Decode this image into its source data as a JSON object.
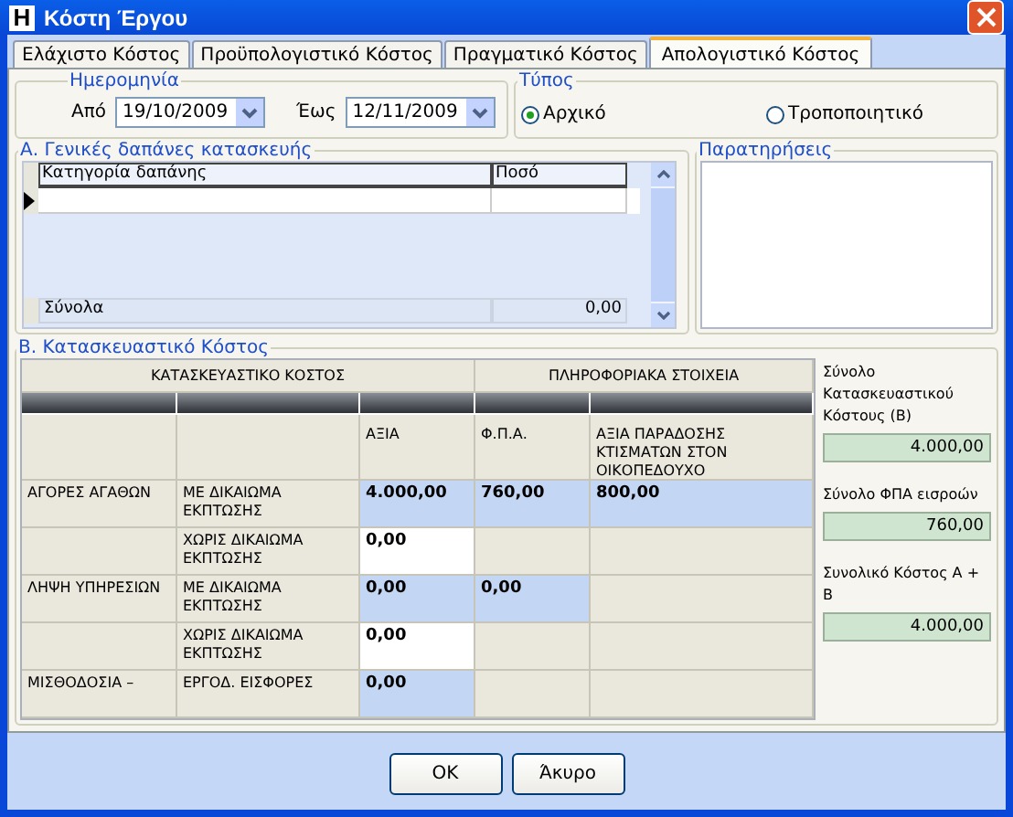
{
  "window": {
    "title": "Κόστη Έργου",
    "icon_letter": "H"
  },
  "tabs": [
    {
      "label": "Ελάχιστο Κόστος",
      "selected": false
    },
    {
      "label": "Προϋπολογιστικό Κόστος",
      "selected": false
    },
    {
      "label": "Πραγματικό Κόστος",
      "selected": false
    },
    {
      "label": "Απολογιστικό Κόστος",
      "selected": true
    }
  ],
  "date_group": {
    "title": "Ημερομηνία",
    "from_label": "Από",
    "from_value": "19/10/2009",
    "to_label": "Έως",
    "to_value": "12/11/2009"
  },
  "type_group": {
    "title": "Τύπος",
    "options": [
      {
        "label": "Αρχικό",
        "selected": true
      },
      {
        "label": "Τροποποιητικό",
        "selected": false
      }
    ]
  },
  "general_costs": {
    "title": "Α. Γενικές δαπάνες κατασκευής",
    "columns": [
      "Κατηγορία δαπάνης",
      "Ποσό"
    ],
    "totals_label": "Σύνολα",
    "totals_value": "0,00"
  },
  "notes": {
    "title": "Παρατηρήσεις"
  },
  "construction": {
    "title": "Β. Κατασκευαστικό Κόστος",
    "group_headers": [
      "ΚΑΤΑΣΚΕΥΑΣΤΙΚΟ ΚΟΣΤΟΣ",
      "ΠΛΗΡΟΦΟΡΙΑΚΑ ΣΤΟΙΧΕΙΑ"
    ],
    "column_headers": [
      "ΑΞΙΑ",
      "Φ.Π.Α.",
      "ΑΞΙΑ ΠΑΡΑΔΟΣΗΣ ΚΤΙΣΜΑΤΩΝ ΣΤΟΝ ΟΙΚΟΠΕΔΟΥΧΟ"
    ],
    "rows": [
      {
        "category": "ΑΓΟΡΕΣ ΑΓΑΘΩΝ",
        "subcategory": "ΜΕ ΔΙΚΑΙΩΜΑ ΕΚΠΤΩΣΗΣ",
        "cells": [
          {
            "kind": "readonly",
            "value": "4.000,00"
          },
          {
            "kind": "readonly",
            "value": "760,00"
          },
          {
            "kind": "readonly",
            "value": "800,00"
          }
        ]
      },
      {
        "subcategory": "ΧΩΡΙΣ ΔΙΚΑΙΩΜΑ ΕΚΠΤΩΣΗΣ",
        "cells": [
          {
            "kind": "editable",
            "value": "0,00"
          },
          {
            "kind": "none"
          },
          {
            "kind": "none"
          }
        ]
      },
      {
        "category": "ΛΗΨΗ ΥΠΗΡΕΣΙΩΝ",
        "subcategory": "ΜΕ ΔΙΚΑΙΩΜΑ ΕΚΠΤΩΣΗΣ",
        "cells": [
          {
            "kind": "readonly",
            "value": "0,00"
          },
          {
            "kind": "readonly",
            "value": "0,00"
          },
          {
            "kind": "none"
          }
        ]
      },
      {
        "subcategory": "ΧΩΡΙΣ ΔΙΚΑΙΩΜΑ ΕΚΠΤΩΣΗΣ",
        "cells": [
          {
            "kind": "editable",
            "value": "0,00"
          },
          {
            "kind": "none"
          },
          {
            "kind": "none"
          }
        ]
      },
      {
        "category": "ΜΙΣΘΟΔΟΣΙΑ –",
        "subcategory": "ΕΡΓΟΔ. ΕΙΣΦΟΡΕΣ",
        "cells": [
          {
            "kind": "readonly",
            "value": "0,00"
          },
          {
            "kind": "none"
          },
          {
            "kind": "none"
          }
        ]
      }
    ]
  },
  "summary": [
    {
      "label": "Σύνολο Κατασκευαστικού Κόστους (Β)",
      "value": "4.000,00"
    },
    {
      "label": "Σύνολο ΦΠΑ εισροών",
      "value": "760,00"
    },
    {
      "label": "Συνολικό Κόστος Α + Β",
      "value": "4.000,00"
    }
  ],
  "buttons": [
    "OK",
    "Άκυρο"
  ]
}
